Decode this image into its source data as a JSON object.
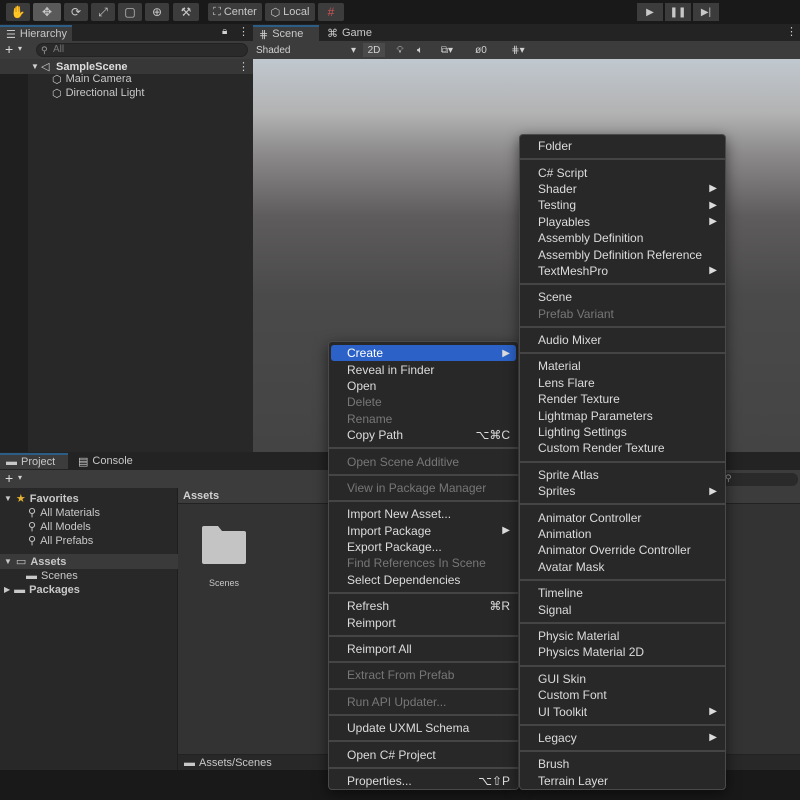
{
  "toolbar": {
    "tools": [
      "hand-tool",
      "move-tool",
      "rotate-tool",
      "scale-tool",
      "rect-tool",
      "transform-tool",
      "custom-tool"
    ],
    "pivot_label": "Center",
    "space_label": "Local"
  },
  "hierarchy": {
    "tab_label": "Hierarchy",
    "search_placeholder": "All",
    "scene_name": "SampleScene",
    "items": [
      "Main Camera",
      "Directional Light"
    ]
  },
  "scene_view": {
    "tabs": [
      "Scene",
      "Game"
    ],
    "shading_mode": "Shaded",
    "mode_2d": "2D",
    "hidden_count": "0"
  },
  "project": {
    "tabs": [
      "Project",
      "Console"
    ],
    "favorites_label": "Favorites",
    "favorites": [
      "All Materials",
      "All Models",
      "All Prefabs"
    ],
    "assets_label": "Assets",
    "asset_children": [
      "Scenes"
    ],
    "packages_label": "Packages",
    "assets_header": "Assets",
    "folder_name": "Scenes",
    "path": "Assets/Scenes"
  },
  "context_menu": {
    "items": [
      {
        "label": "Create",
        "submenu": true,
        "highlight": true
      },
      {
        "label": "Reveal in Finder"
      },
      {
        "label": "Open"
      },
      {
        "label": "Delete",
        "disabled": true
      },
      {
        "label": "Rename",
        "disabled": true
      },
      {
        "label": "Copy Path",
        "shortcut": "⌥⌘C"
      },
      {
        "sep": true
      },
      {
        "label": "Open Scene Additive",
        "disabled": true
      },
      {
        "sep": true
      },
      {
        "label": "View in Package Manager",
        "disabled": true
      },
      {
        "sep": true
      },
      {
        "label": "Import New Asset..."
      },
      {
        "label": "Import Package",
        "submenu": true
      },
      {
        "label": "Export Package..."
      },
      {
        "label": "Find References In Scene",
        "disabled": true
      },
      {
        "label": "Select Dependencies"
      },
      {
        "sep": true
      },
      {
        "label": "Refresh",
        "shortcut": "⌘R"
      },
      {
        "label": "Reimport"
      },
      {
        "sep": true
      },
      {
        "label": "Reimport All"
      },
      {
        "sep": true
      },
      {
        "label": "Extract From Prefab",
        "disabled": true
      },
      {
        "sep": true
      },
      {
        "label": "Run API Updater...",
        "disabled": true
      },
      {
        "sep": true
      },
      {
        "label": "Update UXML Schema"
      },
      {
        "sep": true
      },
      {
        "label": "Open C# Project"
      },
      {
        "sep": true
      },
      {
        "label": "Properties...",
        "shortcut": "⌥⇧P"
      }
    ]
  },
  "create_submenu": {
    "items": [
      {
        "label": "Folder"
      },
      {
        "sep": true
      },
      {
        "label": "C# Script"
      },
      {
        "label": "Shader",
        "submenu": true
      },
      {
        "label": "Testing",
        "submenu": true
      },
      {
        "label": "Playables",
        "submenu": true
      },
      {
        "label": "Assembly Definition"
      },
      {
        "label": "Assembly Definition Reference"
      },
      {
        "label": "TextMeshPro",
        "submenu": true
      },
      {
        "sep": true
      },
      {
        "label": "Scene"
      },
      {
        "label": "Prefab Variant",
        "disabled": true
      },
      {
        "sep": true
      },
      {
        "label": "Audio Mixer"
      },
      {
        "sep": true
      },
      {
        "label": "Material"
      },
      {
        "label": "Lens Flare"
      },
      {
        "label": "Render Texture"
      },
      {
        "label": "Lightmap Parameters"
      },
      {
        "label": "Lighting Settings"
      },
      {
        "label": "Custom Render Texture"
      },
      {
        "sep": true
      },
      {
        "label": "Sprite Atlas"
      },
      {
        "label": "Sprites",
        "submenu": true
      },
      {
        "sep": true
      },
      {
        "label": "Animator Controller"
      },
      {
        "label": "Animation"
      },
      {
        "label": "Animator Override Controller"
      },
      {
        "label": "Avatar Mask"
      },
      {
        "sep": true
      },
      {
        "label": "Timeline"
      },
      {
        "label": "Signal"
      },
      {
        "sep": true
      },
      {
        "label": "Physic Material"
      },
      {
        "label": "Physics Material 2D"
      },
      {
        "sep": true
      },
      {
        "label": "GUI Skin"
      },
      {
        "label": "Custom Font"
      },
      {
        "label": "UI Toolkit",
        "submenu": true
      },
      {
        "sep": true
      },
      {
        "label": "Legacy",
        "submenu": true
      },
      {
        "sep": true
      },
      {
        "label": "Brush"
      },
      {
        "label": "Terrain Layer"
      }
    ]
  },
  "colors": {
    "highlight": "#2c62c7",
    "panel": "#282828",
    "toolbar": "#3c3c3c"
  }
}
